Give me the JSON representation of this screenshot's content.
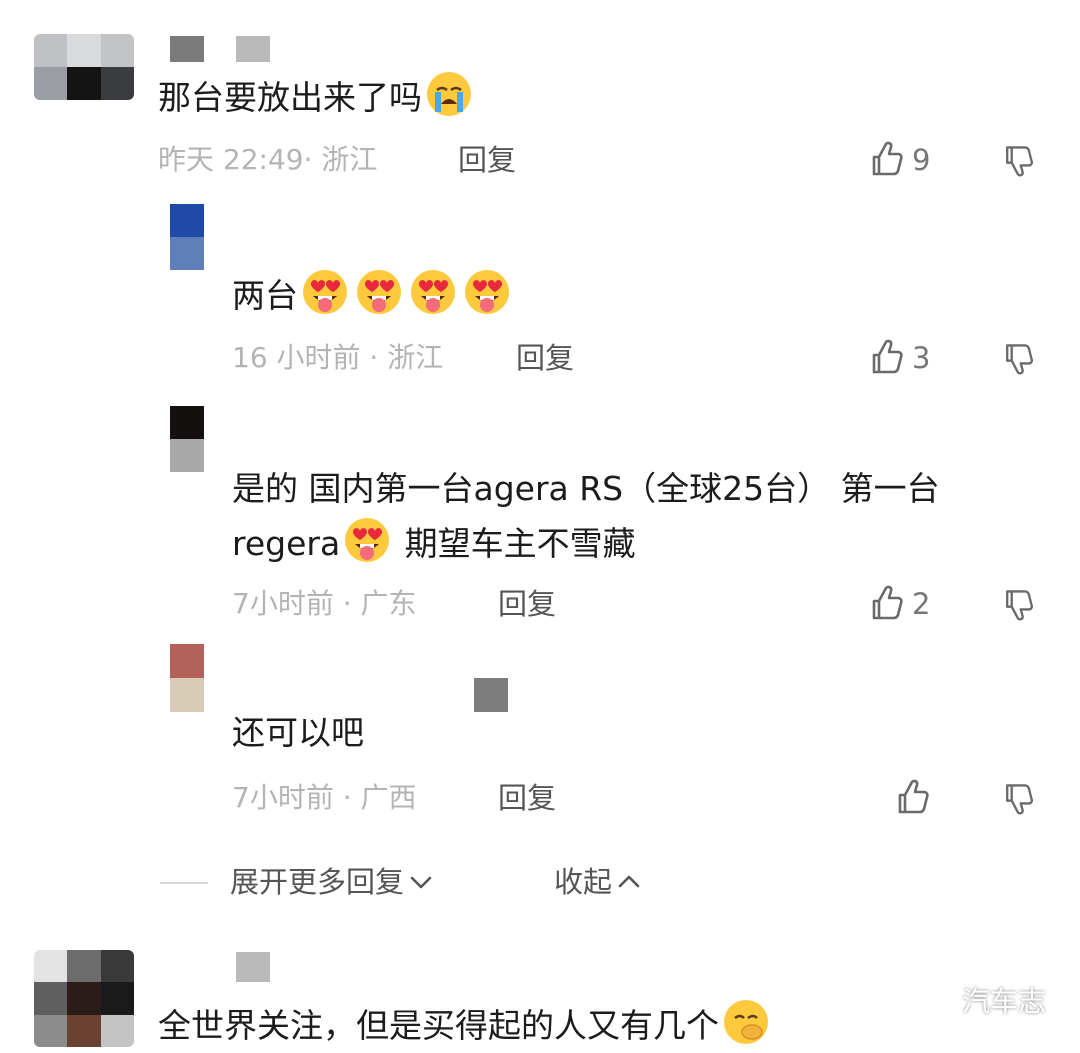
{
  "comments": [
    {
      "text": "那台要放出来了吗",
      "emoji": "crying-emoji",
      "time_location": "昨天 22:49· 浙江",
      "reply_label": "回复",
      "likes": "9"
    }
  ],
  "replies": [
    {
      "text": "两台",
      "emoji": "heart-eyes-tongue-emoji x4",
      "time_location": "16 小时前 · 浙江",
      "reply_label": "回复",
      "likes": "3"
    },
    {
      "text_part1": "是的 国内第一台agera RS（全球25台） 第一台regera",
      "emoji": "heart-eyes-tongue-emoji",
      "text_part2": " 期望车主不雪藏",
      "time_location": "7小时前 · 广东",
      "reply_label": "回复",
      "likes": "2"
    },
    {
      "text": "还可以吧",
      "time_location": "7小时前 · 广西",
      "reply_label": "回复",
      "likes": ""
    }
  ],
  "thread_controls": {
    "expand_label": "展开更多回复",
    "collapse_label": "收起"
  },
  "next_comment": {
    "text": "全世界关注，但是买得起的人又有几个",
    "emoji": "covering-mouth-emoji"
  },
  "watermark": {
    "label": "汽车志",
    "icon": "wechat-icon"
  },
  "colors": {
    "primary_text": "#1c1c1c",
    "meta_text": "#b4b4b4",
    "action_text": "#555555"
  }
}
